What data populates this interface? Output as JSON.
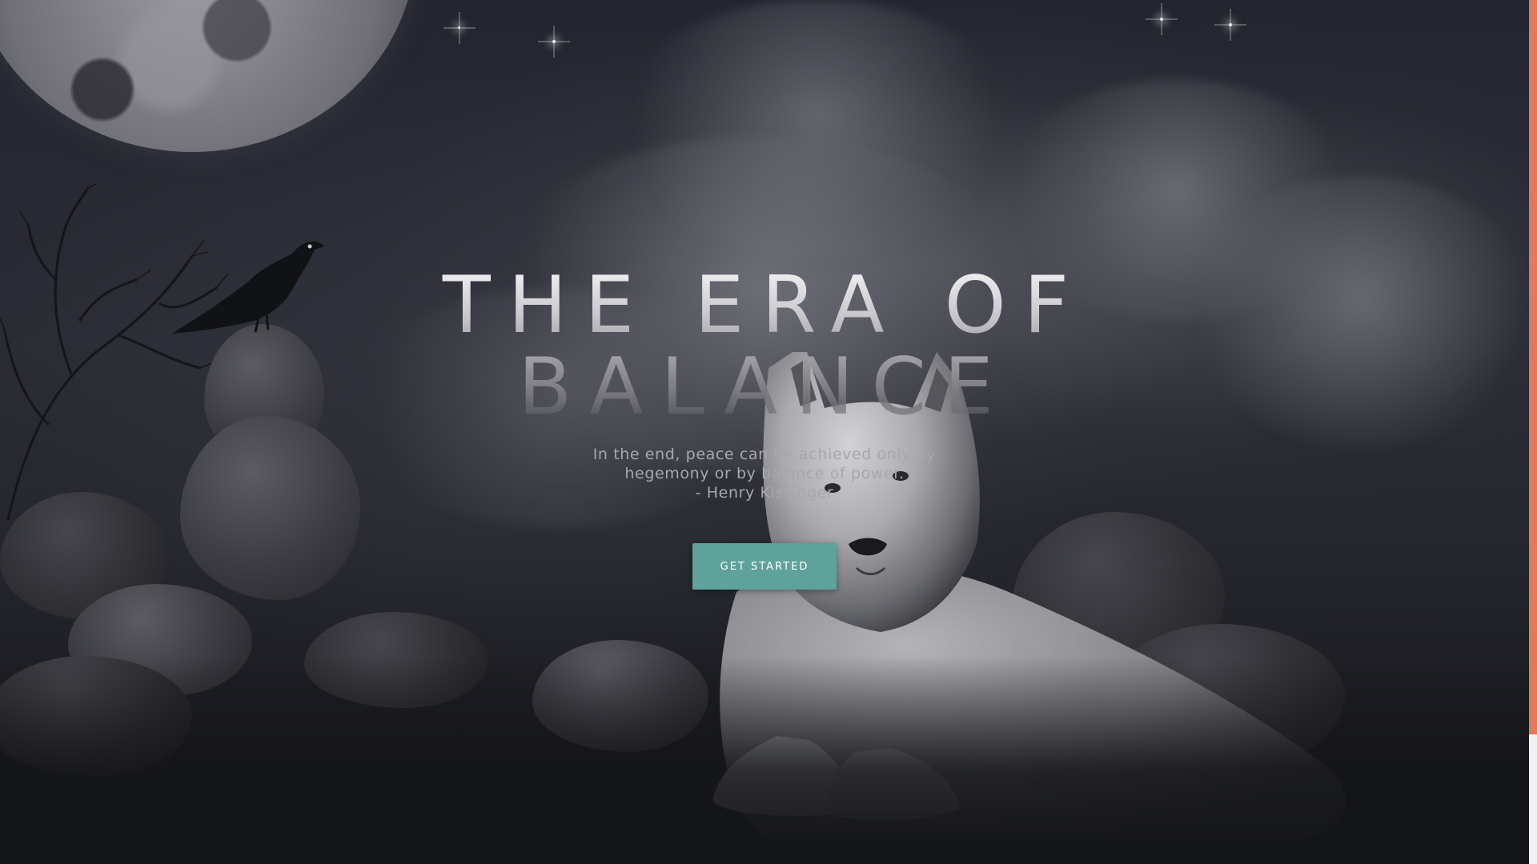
{
  "hero": {
    "title": "THE ERA OF",
    "subtitle": "BALANCE",
    "quote_line_1": "In the end, peace can be achieved only by",
    "quote_line_2": "hegemony or by balance of power.",
    "quote_attribution": "- Henry Kissinger"
  },
  "cta": {
    "label": "GET STARTED"
  },
  "colors": {
    "accent_button": "#5fa19b",
    "edge_bar": "#e27a55",
    "background": "#25262d"
  },
  "icons": {
    "moon": "moon-illustration",
    "crow": "crow-illustration",
    "wolf": "wolf-illustration"
  }
}
